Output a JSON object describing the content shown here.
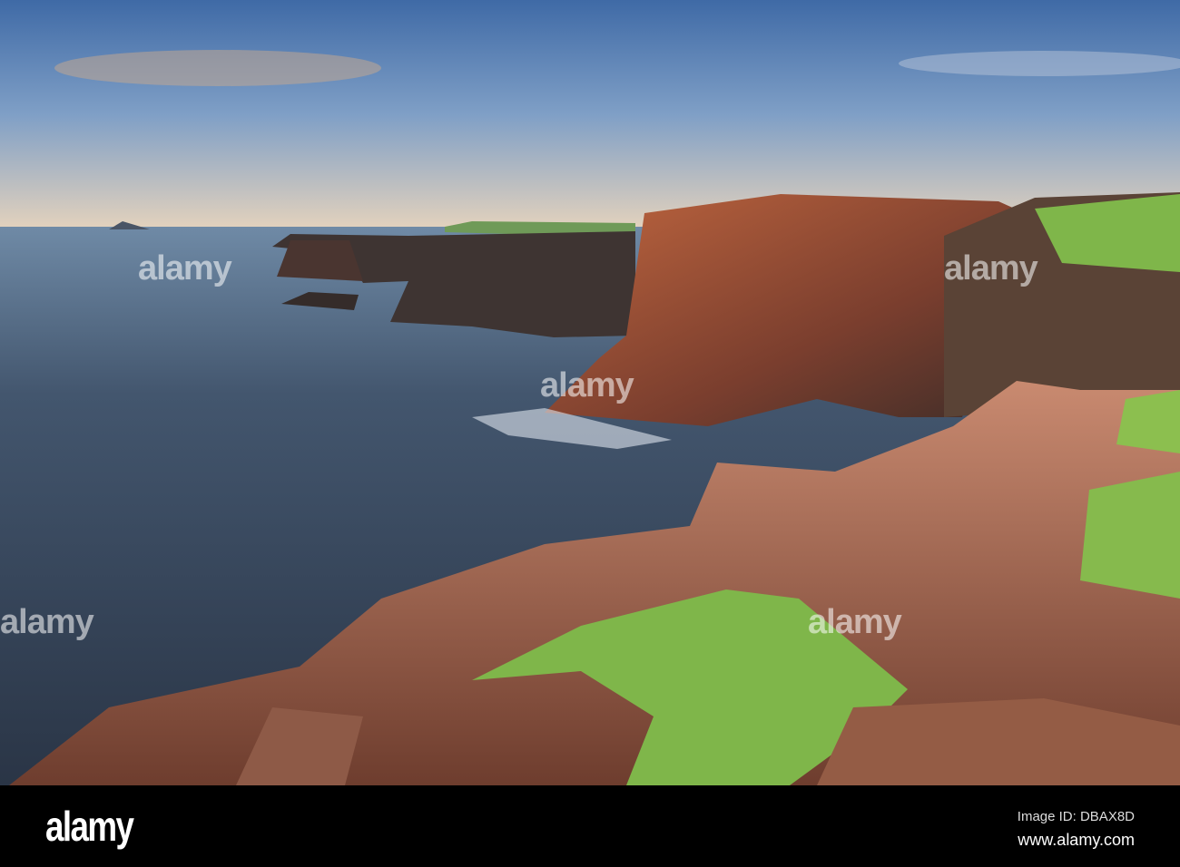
{
  "photo": {
    "subject": "sea-cliffs-coastline",
    "colors": {
      "sky": "#5f86b8",
      "sea": "#3a4a5e",
      "cliff": "#a4563e",
      "grass": "#7fb64a"
    }
  },
  "watermark": {
    "text": "alamy"
  },
  "footer": {
    "logo": "alamy",
    "image_id": "Image ID: DBAX8D",
    "url": "www.alamy.com"
  }
}
